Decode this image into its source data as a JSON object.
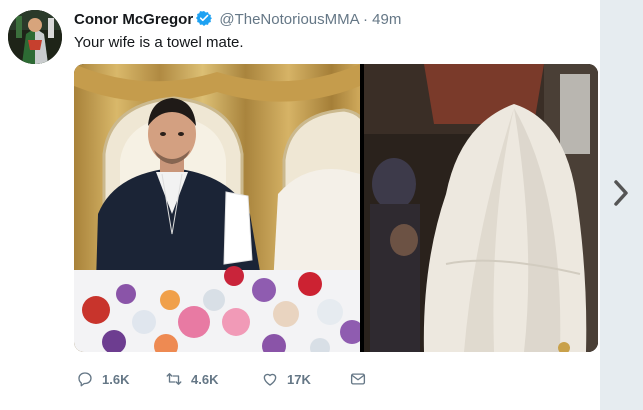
{
  "tweet": {
    "author_name": "Conor McGregor",
    "handle": "@TheNotoriousMMA",
    "separator": "·",
    "time": "49m",
    "text": "Your wife is a towel mate.",
    "verified": true
  },
  "actions": {
    "replies": "1.6K",
    "retweets": "4.6K",
    "likes": "17K"
  },
  "icons": {
    "reply": "reply-icon",
    "retweet": "retweet-icon",
    "like": "heart-icon",
    "message": "envelope-icon",
    "verified": "verified-badge-icon",
    "next": "chevron-right-icon"
  },
  "colors": {
    "name": "#14171a",
    "secondary": "#657786",
    "verified_blue": "#1da1f2",
    "background": "#ffffff",
    "gutter": "#e6ecf0"
  }
}
